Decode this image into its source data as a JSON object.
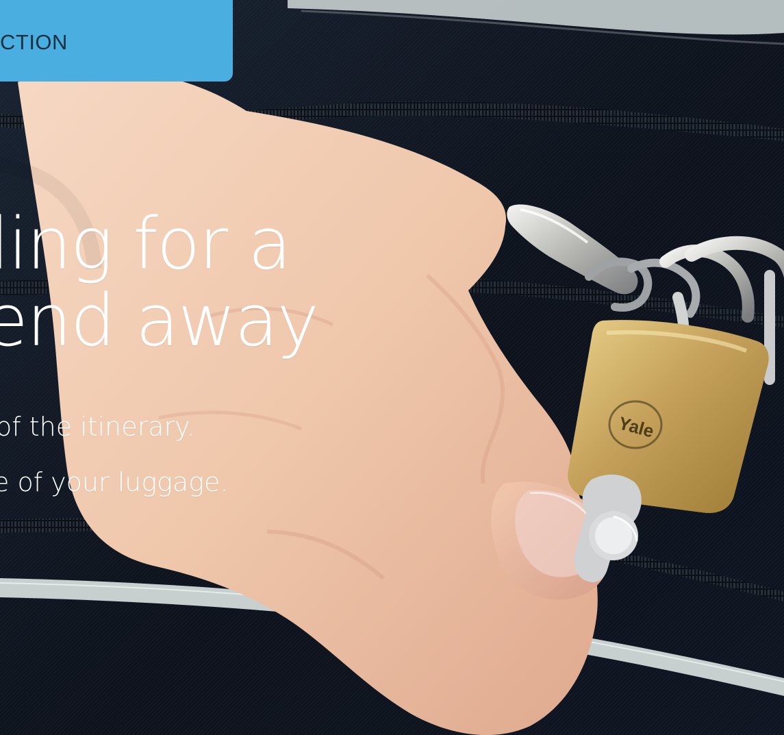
{
  "section_badge": {
    "label": "CTION"
  },
  "hero": {
    "headline_line_1": "ling for a",
    "headline_line_2": "end away",
    "body_line_1": "of the itinerary.",
    "body_line_2": "e of your luggage.",
    "padlock_brand": "Yale"
  },
  "theme": {
    "accent": "#4aaee0",
    "bag_dark": "#0f1521",
    "piping": "#c8cfcf",
    "brass": "#c8ab63",
    "skin": "#f0c9ae"
  }
}
